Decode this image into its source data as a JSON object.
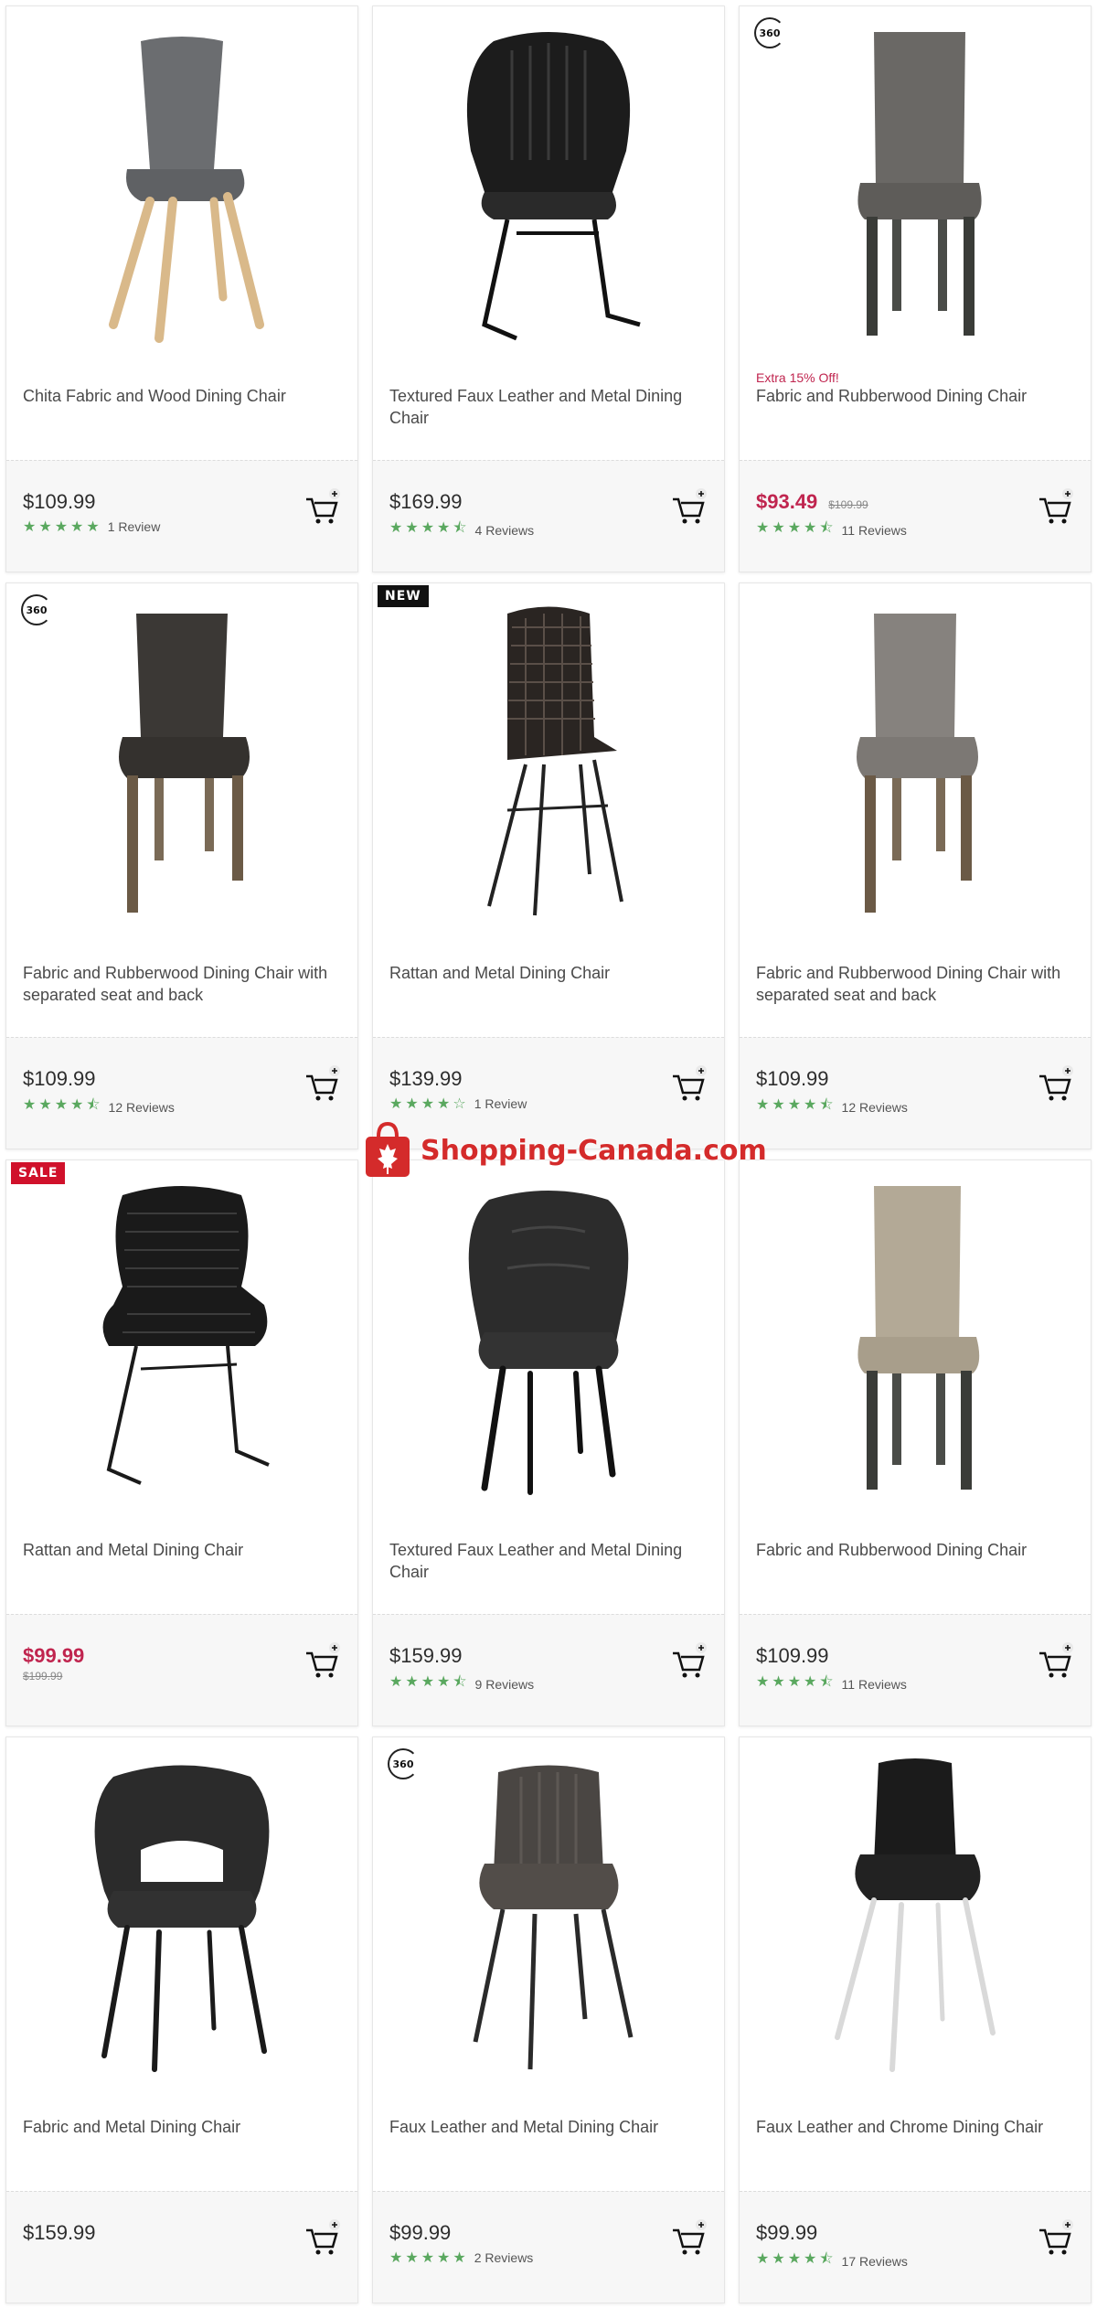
{
  "colors": {
    "accent_sale": "#c0254f",
    "star": "#5aa85f",
    "new_badge": "#111111",
    "sale_badge": "#d0112b"
  },
  "products": [
    {
      "title": "Chita Fabric and Wood Dining Chair",
      "promo": "",
      "price": "$109.99",
      "old_price": "",
      "stars": "★★★★★",
      "reviews": "1 Review",
      "badge": "",
      "icon": "upholstered-chair-icon"
    },
    {
      "title": "Textured Faux Leather and Metal Dining Chair",
      "promo": "",
      "price": "$169.99",
      "old_price": "",
      "stars": "★★★★⯪",
      "reviews": "4 Reviews",
      "badge": "",
      "icon": "leather-armchair-icon"
    },
    {
      "title": "Fabric and Rubberwood Dining Chair",
      "promo": "Extra 15% Off!",
      "price": "$93.49",
      "old_price": "$109.99",
      "stars": "★★★★⯪",
      "reviews": "11 Reviews",
      "badge": "360",
      "icon": "parsons-chair-icon"
    },
    {
      "title": "Fabric and Rubberwood Dining Chair with separated seat and back",
      "promo": "",
      "price": "$109.99",
      "old_price": "",
      "stars": "★★★★⯪",
      "reviews": "12 Reviews",
      "badge": "360",
      "icon": "upholstered-chair-icon"
    },
    {
      "title": "Rattan and Metal Dining Chair",
      "promo": "",
      "price": "$139.99",
      "old_price": "",
      "stars": "★★★★☆",
      "reviews": "1 Review",
      "badge": "NEW",
      "icon": "rattan-chair-icon"
    },
    {
      "title": "Fabric and Rubberwood Dining Chair with separated seat and back",
      "promo": "",
      "price": "$109.99",
      "old_price": "",
      "stars": "★★★★⯪",
      "reviews": "12 Reviews",
      "badge": "",
      "icon": "upholstered-chair-icon"
    },
    {
      "title": "Rattan and Metal Dining Chair",
      "promo": "",
      "price": "$99.99",
      "old_price": "$199.99",
      "stars": "",
      "reviews": "",
      "badge": "SALE",
      "icon": "rattan-armchair-icon"
    },
    {
      "title": "Textured Faux Leather and Metal Dining Chair",
      "promo": "",
      "price": "$159.99",
      "old_price": "",
      "stars": "★★★★⯪",
      "reviews": "9 Reviews",
      "badge": "",
      "icon": "leather-armchair-icon"
    },
    {
      "title": "Fabric and Rubberwood Dining Chair",
      "promo": "",
      "price": "$109.99",
      "old_price": "",
      "stars": "★★★★⯪",
      "reviews": "11 Reviews",
      "badge": "",
      "icon": "parsons-chair-icon"
    },
    {
      "title": "Fabric and Metal Dining Chair",
      "promo": "",
      "price": "$159.99",
      "old_price": "",
      "stars": "",
      "reviews": "",
      "badge": "",
      "icon": "fabric-armchair-icon"
    },
    {
      "title": "Faux Leather and Metal Dining Chair",
      "promo": "",
      "price": "$99.99",
      "old_price": "",
      "stars": "★★★★★",
      "reviews": "2 Reviews",
      "badge": "360",
      "icon": "leather-chair-icon"
    },
    {
      "title": "Faux Leather and Chrome Dining Chair",
      "promo": "",
      "price": "$99.99",
      "old_price": "",
      "stars": "★★★★⯪",
      "reviews": "17 Reviews",
      "badge": "",
      "icon": "leather-chair-icon"
    }
  ],
  "watermark": {
    "text": "Shopping-Canada.com",
    "icon": "shopping-bag-maple-leaf-icon"
  }
}
